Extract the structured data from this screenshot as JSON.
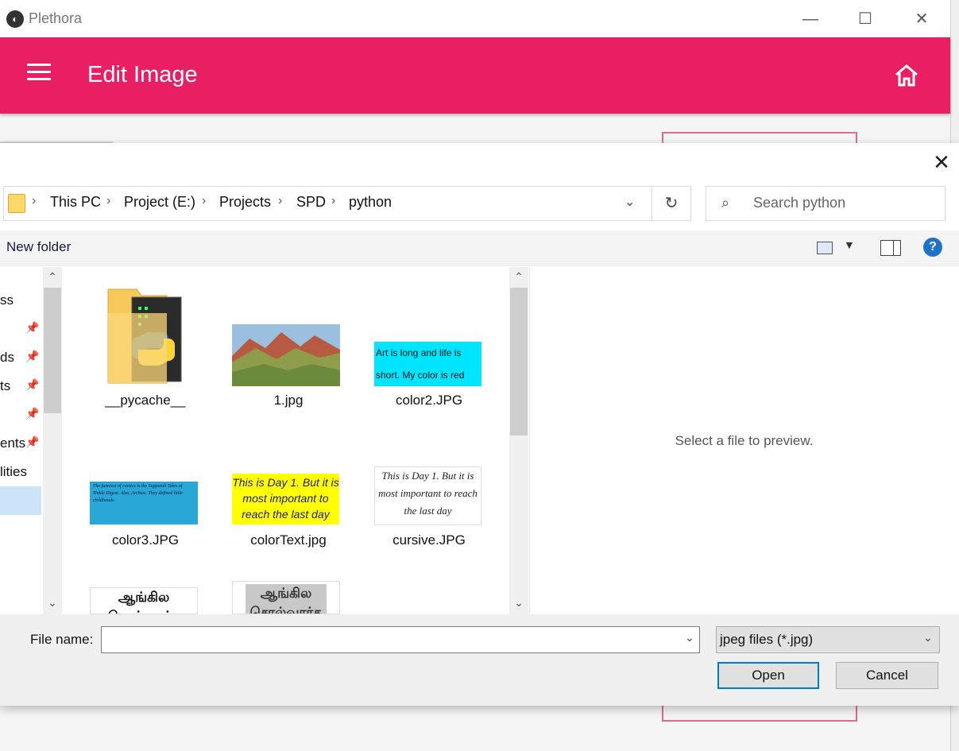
{
  "app": {
    "title": "Plethora",
    "toolbar_title": "Edit Image",
    "minimize_icon": "minimize-icon",
    "maximize_icon": "maximize-icon",
    "close_icon": "close-icon",
    "menu_icon": "hamburger-menu-icon",
    "home_icon": "home-icon",
    "accent_color": "#e91e63"
  },
  "dialog": {
    "breadcrumb": [
      "This PC",
      "Project (E:)",
      "Projects",
      "SPD",
      "python"
    ],
    "search_placeholder": "Search python",
    "new_folder_label": "New folder",
    "nav_items": [
      "ss",
      "",
      "ds",
      "ts",
      "",
      "ents",
      "lities",
      ""
    ],
    "files": [
      {
        "name": "__pycache__",
        "type": "folder"
      },
      {
        "name": "1.jpg",
        "type": "image"
      },
      {
        "name": "color2.JPG",
        "type": "image",
        "thumb_text": "Art is long and life is short. My color is red"
      },
      {
        "name": "color3.JPG",
        "type": "image",
        "thumb_text": "The funniest of comics is the Suppandi Tales of Tinkle Digest. Also, Archies. They defined little childhoods."
      },
      {
        "name": "colorText.jpg",
        "type": "image",
        "thumb_text": "This is Day 1. But it is most important to reach the last day"
      },
      {
        "name": "cursive.JPG",
        "type": "image",
        "thumb_text": "This is Day 1. But it is most important to reach the last day"
      },
      {
        "name": "",
        "type": "image",
        "thumb_text": "ஆங்கில சொல்வார்த"
      },
      {
        "name": "",
        "type": "image",
        "thumb_text": "ஆங்கில சொல்வார்த"
      }
    ],
    "preview_text": "Select a file to preview.",
    "filename_label": "File name:",
    "filename_value": "",
    "filetype_selected": "jpeg files (*.jpg)",
    "open_label": "Open",
    "cancel_label": "Cancel",
    "help_label": "?"
  }
}
